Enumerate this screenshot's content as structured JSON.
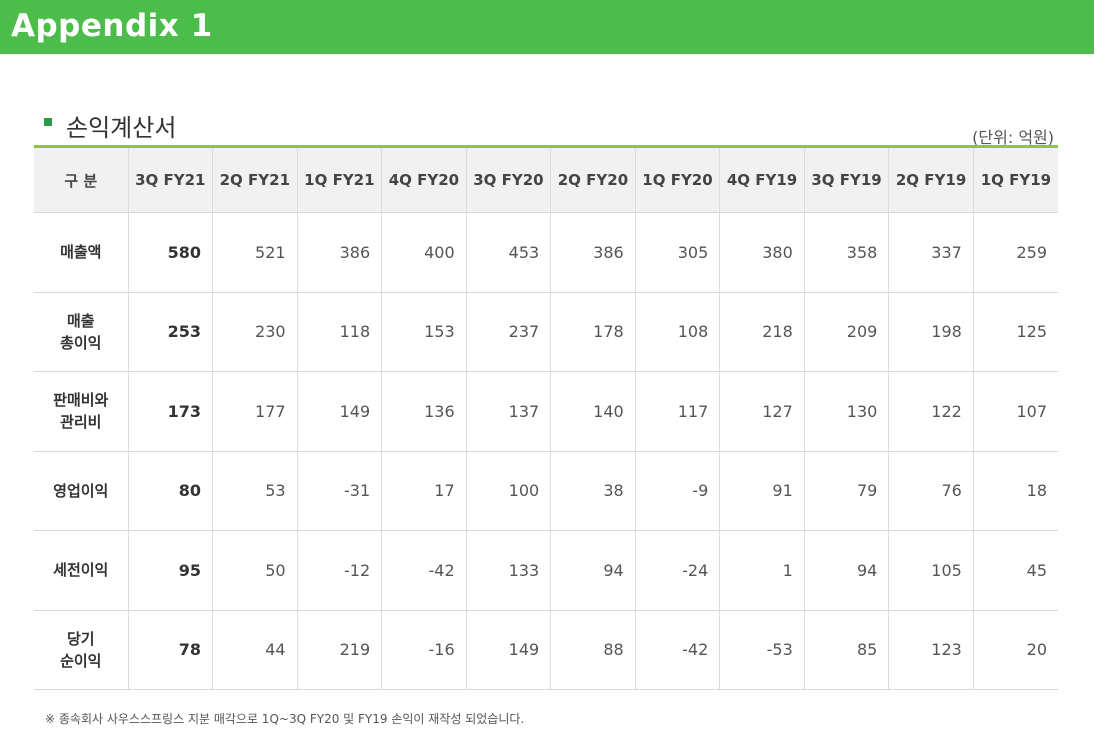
{
  "header": {
    "title": "Appendix 1"
  },
  "section": {
    "title": "손익계산서",
    "unit": "(단위: 억원)"
  },
  "table": {
    "label_header": "구 분",
    "columns": [
      "3Q FY21",
      "2Q FY21",
      "1Q FY21",
      "4Q FY20",
      "3Q FY20",
      "2Q FY20",
      "1Q FY20",
      "4Q FY19",
      "3Q FY19",
      "2Q FY19",
      "1Q FY19"
    ],
    "rows": [
      {
        "label": "매출액",
        "values": [
          "580",
          "521",
          "386",
          "400",
          "453",
          "386",
          "305",
          "380",
          "358",
          "337",
          "259"
        ]
      },
      {
        "label": "매출\n총이익",
        "values": [
          "253",
          "230",
          "118",
          "153",
          "237",
          "178",
          "108",
          "218",
          "209",
          "198",
          "125"
        ]
      },
      {
        "label": "판매비와\n관리비",
        "values": [
          "173",
          "177",
          "149",
          "136",
          "137",
          "140",
          "117",
          "127",
          "130",
          "122",
          "107"
        ]
      },
      {
        "label": "영업이익",
        "values": [
          "80",
          "53",
          "-31",
          "17",
          "100",
          "38",
          "-9",
          "91",
          "79",
          "76",
          "18"
        ]
      },
      {
        "label": "세전이익",
        "values": [
          "95",
          "50",
          "-12",
          "-42",
          "133",
          "94",
          "-24",
          "1",
          "94",
          "105",
          "45"
        ]
      },
      {
        "label": "당기\n순이익",
        "values": [
          "78",
          "44",
          "219",
          "-16",
          "149",
          "88",
          "-42",
          "-53",
          "85",
          "123",
          "20"
        ]
      }
    ]
  },
  "footnote": "※ 종속회사 사우스스프링스 지분 매각으로 1Q~3Q FY20 및 FY19 손익이 재작성 되었습니다.",
  "colors": {
    "banner": "#4cbd4a",
    "rule": "#8cc63f",
    "bullet": "#2e9b48",
    "header_bg": "#f1f1f1"
  }
}
